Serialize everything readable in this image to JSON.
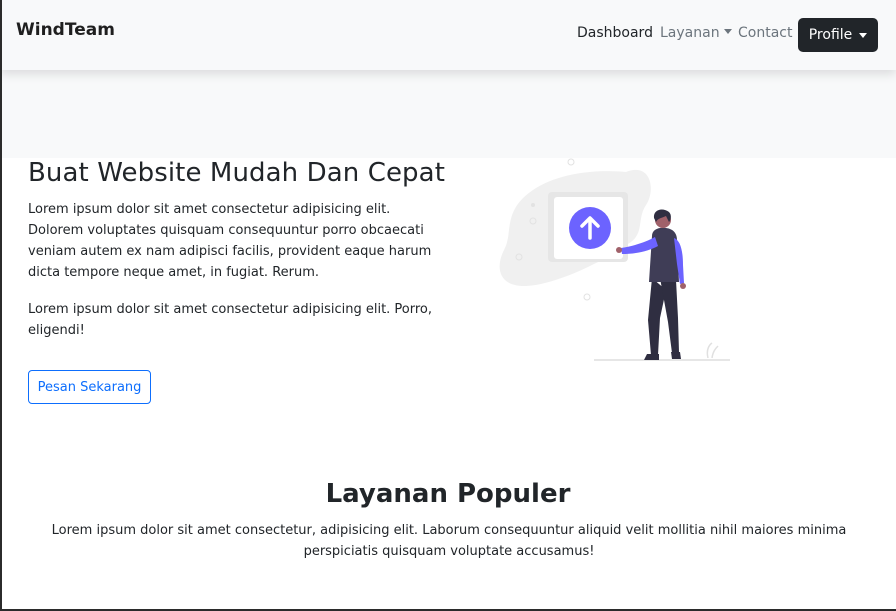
{
  "navbar": {
    "brand": "WindTeam",
    "links": [
      {
        "label": "Dashboard"
      },
      {
        "label": "Layanan"
      },
      {
        "label": "Contact"
      }
    ],
    "profile_label": "Profile"
  },
  "hero": {
    "title": "Buat Website Mudah Dan Cepat",
    "paragraph1": "Lorem ipsum dolor sit amet consectetur adipisicing elit. Dolorem voluptates quisquam consequuntur porro obcaecati veniam autem ex nam adipisci facilis, provident eaque harum dicta tempore neque amet, in fugiat. Rerum.",
    "paragraph2": "Lorem ipsum dolor sit amet consectetur adipisicing elit. Porro, eligendi!",
    "cta_label": "Pesan Sekarang",
    "illustration_icon": "upload-arrow-icon",
    "accent_color": "#6c63ff"
  },
  "services": {
    "title": "Layanan Populer",
    "description": "Lorem ipsum dolor sit amet consectetur, adipisicing elit. Laborum consequuntur aliquid velit mollitia nihil maiores minima perspiciatis quisquam voluptate accusamus!"
  }
}
